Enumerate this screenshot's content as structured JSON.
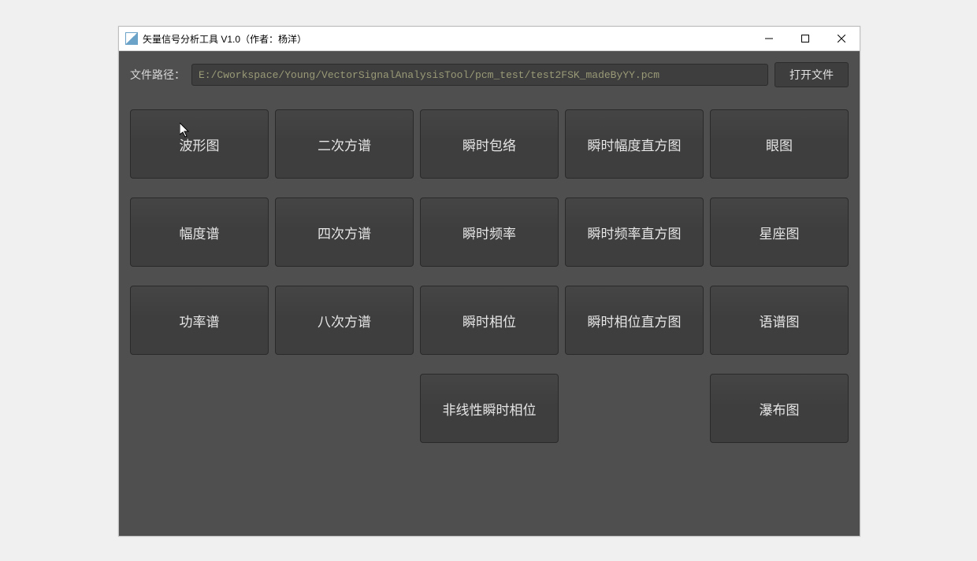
{
  "window": {
    "title": "矢量信号分析工具 V1.0（作者：杨洋）"
  },
  "path_row": {
    "label": "文件路径：",
    "value": "E:/Cworkspace/Young/VectorSignalAnalysisTool/pcm_test/test2FSK_madeByYY.pcm",
    "open_label": "打开文件"
  },
  "grid": {
    "rows": [
      [
        "波形图",
        "二次方谱",
        "瞬时包络",
        "瞬时幅度直方图",
        "眼图"
      ],
      [
        "幅度谱",
        "四次方谱",
        "瞬时频率",
        "瞬时频率直方图",
        "星座图"
      ],
      [
        "功率谱",
        "八次方谱",
        "瞬时相位",
        "瞬时相位直方图",
        "语谱图"
      ],
      [
        "",
        "",
        "非线性瞬时相位",
        "",
        "瀑布图"
      ]
    ]
  }
}
